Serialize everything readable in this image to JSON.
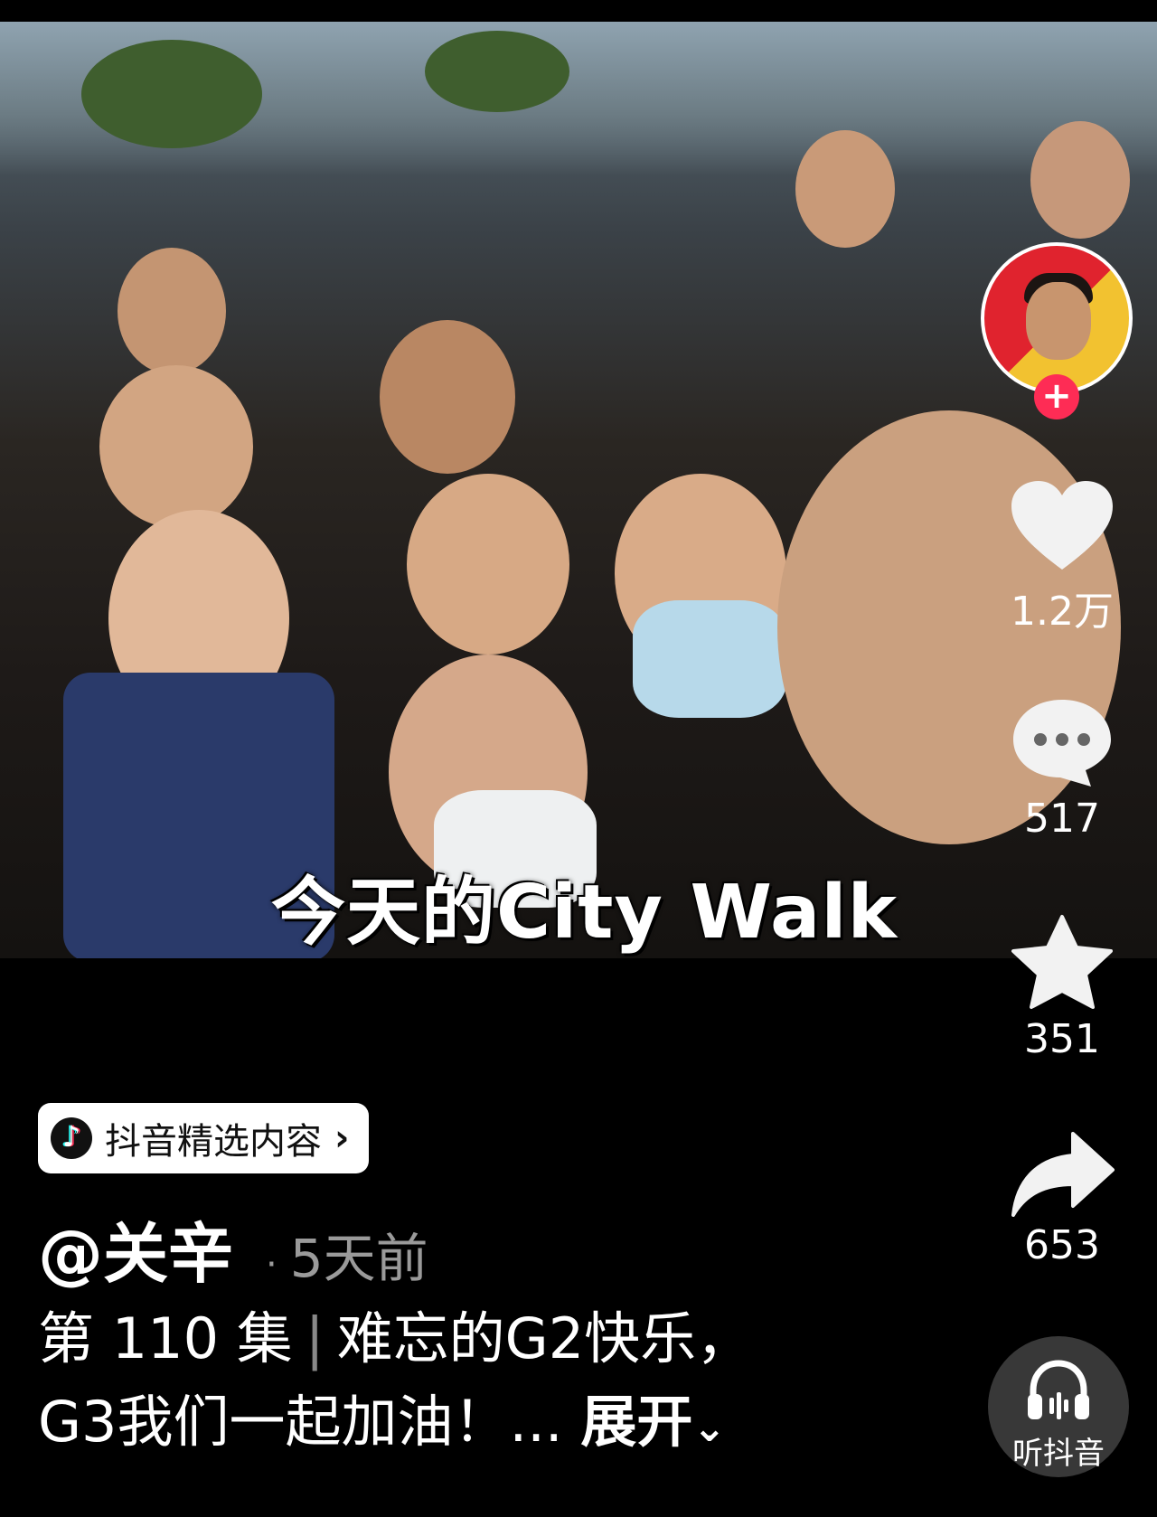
{
  "video": {
    "caption": "今天的City Walk"
  },
  "author": {
    "handle": "@关辛",
    "time": "5天前"
  },
  "badge": {
    "label": "抖音精选内容"
  },
  "description": {
    "line1_part1": "第 110 集",
    "line1_part2": "难忘的G2快乐，",
    "line2": "G3我们一起加油！...",
    "expand_label": "展开"
  },
  "actions": {
    "like_count": "1.2万",
    "comment_count": "517",
    "favorite_count": "351",
    "share_count": "653",
    "listen_label": "听抖音"
  },
  "icons": {
    "follow": "plus-icon",
    "like": "heart-icon",
    "comment": "comment-bubble-icon",
    "favorite": "star-icon",
    "share": "share-arrow-icon",
    "listen": "headphones-icon"
  },
  "colors": {
    "follow_button": "#fe2c55",
    "background": "#000000"
  }
}
